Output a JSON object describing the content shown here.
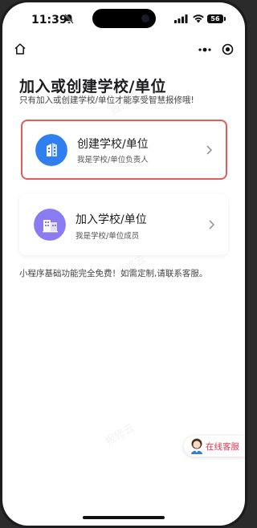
{
  "status_bar": {
    "time": "11:39",
    "battery": "56"
  },
  "nav": {
    "home_icon": "home-icon",
    "more_icon": "more-dots-icon",
    "close_icon": "target-icon"
  },
  "page": {
    "title": "加入或创建学校/单位",
    "subtitle": "只有加入或创建学校/单位才能享受智慧报修哦!"
  },
  "cards": [
    {
      "title": "创建学校/单位",
      "desc": "我是学校/单位负责人",
      "icon": "building-icon",
      "icon_color": "#2f7ff3"
    },
    {
      "title": "加入学校/单位",
      "desc": "我是学校/单位成员",
      "icon": "office-building-icon",
      "icon_color": "#8a7bf3"
    }
  ],
  "footer_note": "小程序基础功能完全免费！如需定制,请联系客服。",
  "watermark": "报修云",
  "customer_service": {
    "label": "在线客服",
    "color": "#e8344e"
  },
  "colors": {
    "highlight_border": "#e45b5b"
  }
}
